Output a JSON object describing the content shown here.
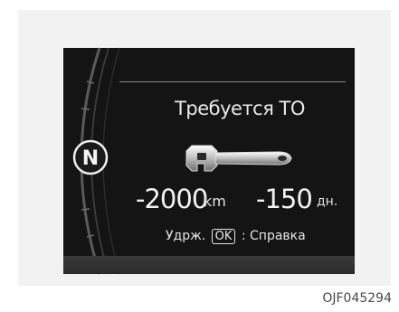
{
  "display": {
    "title": "Требуется ТО",
    "distance_value": "-2000",
    "distance_unit": "km",
    "days_value": "-150",
    "days_unit": "дн.",
    "help_prefix": "Удрж.",
    "help_button": "OK",
    "help_suffix": ": Справка"
  },
  "gear": {
    "label": "N"
  },
  "figure_code": "OJF045294",
  "colors": {
    "screen": "#141414",
    "text": "#e8e8e8",
    "frame": "#f2f2f2"
  },
  "icons": {
    "wrench": "wrench-icon",
    "gear": "gear-indicator"
  }
}
